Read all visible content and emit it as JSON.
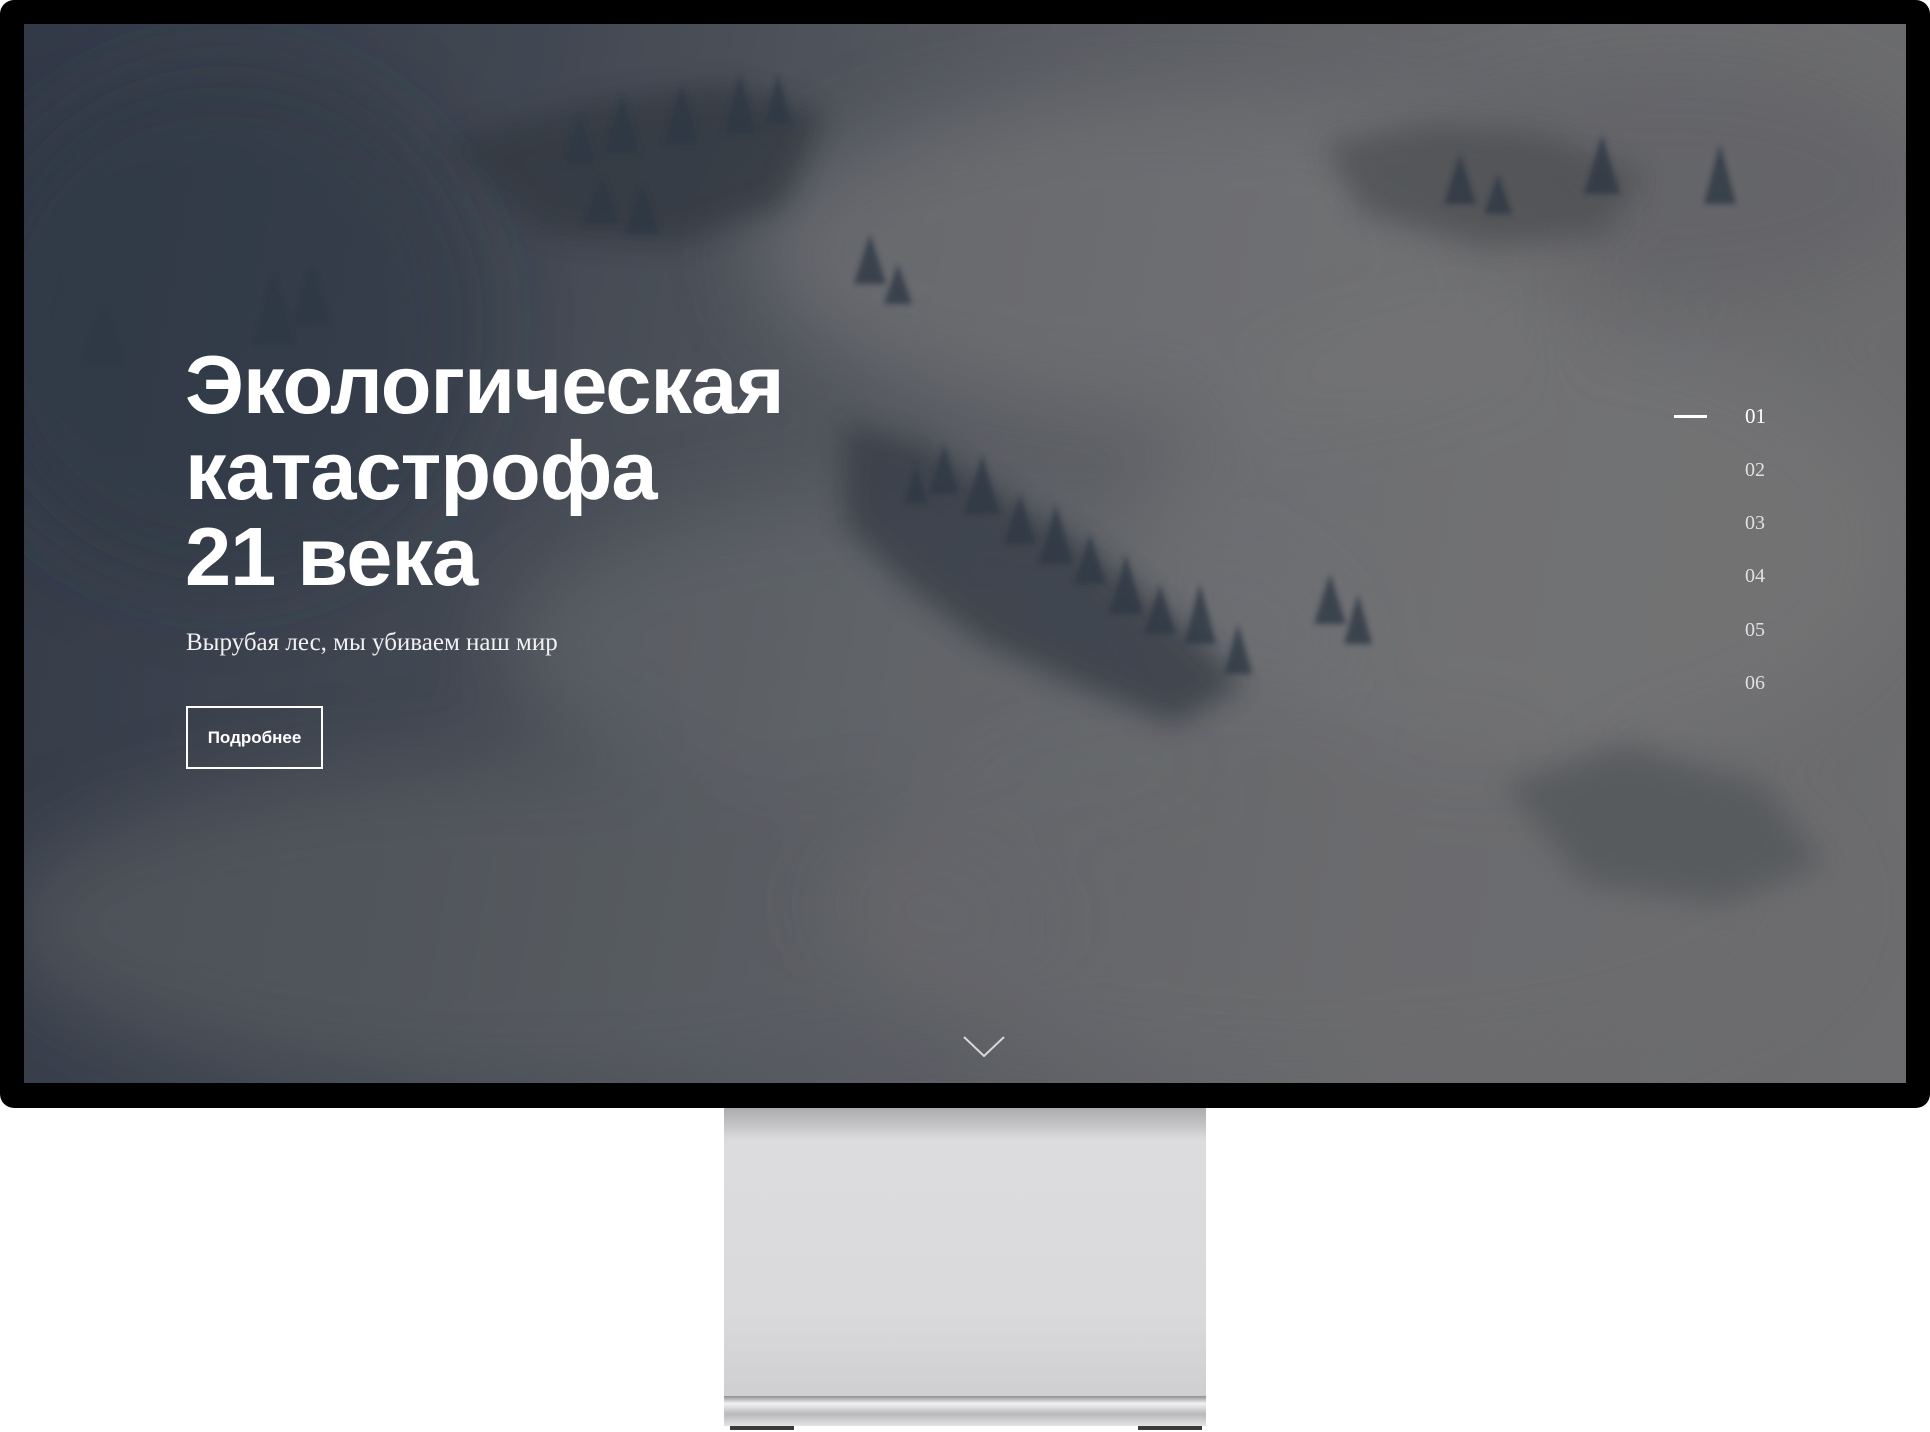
{
  "hero": {
    "title_lines": [
      "Экологическая",
      "катастрофа",
      "21 века"
    ],
    "subtitle": "Вырубая лес, мы убиваем наш мир",
    "button_label": "Подробнее"
  },
  "slide_nav": {
    "active_index": 0,
    "items": [
      "01",
      "02",
      "03",
      "04",
      "05",
      "06"
    ]
  },
  "icons": {
    "scroll_down": "chevron-down-icon"
  },
  "colors": {
    "monitor_bezel": "#000000",
    "text": "#ffffff",
    "stand": "#dadadc"
  }
}
